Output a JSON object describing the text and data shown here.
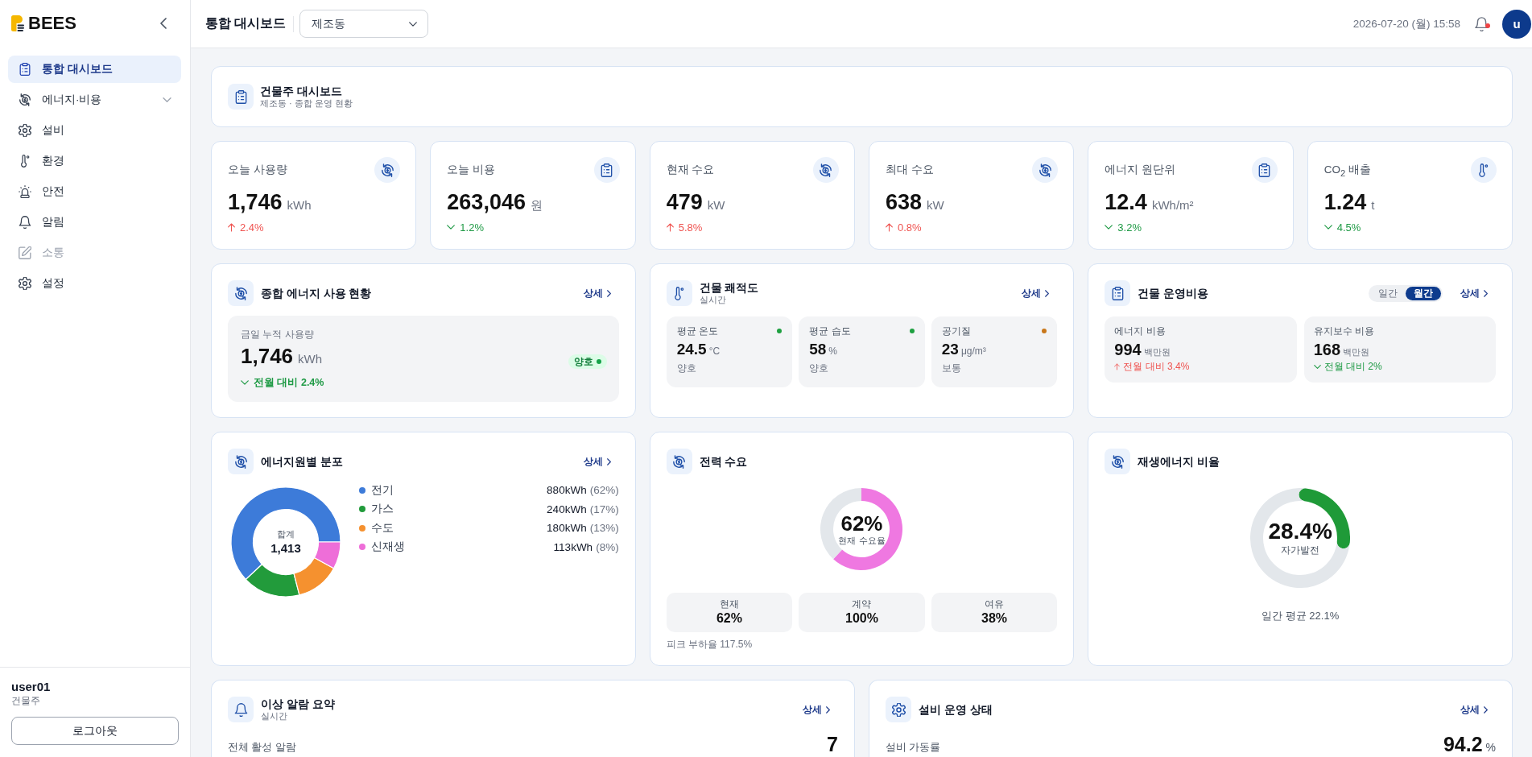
{
  "sidebar": {
    "logo": "BEES",
    "items": [
      {
        "label": "통합 대시보드",
        "selected": true,
        "disabled": false
      },
      {
        "label": "에너지·비용",
        "selected": false,
        "disabled": false,
        "expanded": false
      },
      {
        "label": "설비",
        "selected": false,
        "disabled": false
      },
      {
        "label": "환경",
        "selected": false,
        "disabled": false
      },
      {
        "label": "안전",
        "selected": false,
        "disabled": false
      },
      {
        "label": "알림",
        "selected": false,
        "disabled": false
      },
      {
        "label": "소통",
        "selected": false,
        "disabled": true
      },
      {
        "label": "설정",
        "selected": false,
        "disabled": false
      }
    ],
    "user": {
      "name": "user01",
      "role": "건물주"
    },
    "logout_button": "로그아웃"
  },
  "topbar": {
    "title": "통합 대시보드",
    "site_select": {
      "value": "제조동"
    },
    "datetime": "2026-07-20 (월) 15:58",
    "notifications": {
      "unread": true
    },
    "avatar": "u"
  },
  "header": {
    "title": "건물주 대시보드",
    "subtitle": "제조동 · 종합 운영 현황"
  },
  "kpis": [
    {
      "label": "오늘 사용량",
      "value": "1,746",
      "unit": "kWh",
      "increase": true,
      "change": "2.4%"
    },
    {
      "label": "오늘 비용",
      "value": "263,046",
      "unit": "원",
      "increase": false,
      "change": "1.2%"
    },
    {
      "label": "현재 수요",
      "value": "479",
      "unit": "kW",
      "increase": true,
      "change": "5.8%"
    },
    {
      "label": "최대 수요",
      "value": "638",
      "unit": "kW",
      "increase": true,
      "change": "0.8%"
    },
    {
      "label": "에너지 원단위",
      "value": "12.4",
      "unit": "kWh/m²",
      "increase": false,
      "change": "3.2%"
    },
    {
      "label": "CO$_{2}$ 배출",
      "value": "1.24",
      "unit": "t",
      "increase": false,
      "change": "4.5%"
    }
  ],
  "energy_overview": {
    "title": "종합 에너지 사용 현황",
    "link": "상세",
    "label": "금일 누적 사용량",
    "value": "1,746",
    "unit": "kWh",
    "increase": false,
    "change": "전월 대비 2.4%",
    "badge": "양호"
  },
  "comfort": {
    "title": "건물 쾌적도",
    "subtitle": "실시간",
    "link": "상세",
    "metrics": [
      {
        "label": "평균 온도",
        "value": "24.5",
        "unit": "°C",
        "status": "양호",
        "color": "#1ea040"
      },
      {
        "label": "평균 습도",
        "value": "58",
        "unit": "%",
        "status": "양호",
        "color": "#1ea040"
      },
      {
        "label": "공기질",
        "value": "23",
        "unit": "μg/m³",
        "status": "보통",
        "color": "#c8771b"
      }
    ]
  },
  "operating_cost": {
    "title": "건물 운영비용",
    "periods": [
      {
        "label": "일간",
        "selected": false
      },
      {
        "label": "월간",
        "selected": true
      }
    ],
    "link": "상세",
    "items": [
      {
        "label": "에너지 비용",
        "value": "994",
        "unit": "백만원",
        "increase": true,
        "change": "전월 대비 3.4%"
      },
      {
        "label": "유지보수 비용",
        "value": "168",
        "unit": "백만원",
        "increase": false,
        "change": "전월 대비 2%"
      }
    ]
  },
  "energy_sources": {
    "title": "에너지원별 분포",
    "link": "상세",
    "total_label": "합계",
    "total": "1,413",
    "legend": [
      {
        "value": "880kWh",
        "share": "(62%)",
        "color": "#3d7bd9"
      },
      {
        "value": "240kWh",
        "share": "(17%)",
        "color": "#229b3b"
      },
      {
        "value": "180kWh",
        "share": "(13%)",
        "color": "#f5912f"
      },
      {
        "value": "113kWh",
        "share": "(8%)",
        "color": "#ee6ed8"
      }
    ],
    "chart_data": {
      "type": "donut",
      "categories": [
        "전기",
        "가스",
        "수도",
        "신재생"
      ],
      "series": [
        {
          "values": [
            62,
            17,
            13,
            8
          ]
        }
      ]
    }
  },
  "power_demand": {
    "title": "전력 수요",
    "chart_data": {
      "type": "donut",
      "series": [
        {
          "values": [
            62,
            38
          ]
        }
      ]
    },
    "value": "62%",
    "caption": "현재 수요율",
    "stats": [
      {
        "label": "현재",
        "value": "62%"
      },
      {
        "label": "계약",
        "value": "100%"
      },
      {
        "label": "여유",
        "value": "38%"
      }
    ],
    "footer": "피크 부하율 117.5%"
  },
  "renewable": {
    "title": "재생에너지 비율",
    "chart_data": {
      "type": "donut",
      "series": [
        {
          "values": [
            28.4,
            71.6
          ]
        }
      ]
    },
    "value": "28.4%",
    "caption": "자가발전",
    "footer": "일간 평균 22.1%"
  },
  "alarms": {
    "title": "이상 알람 요약",
    "subtitle": "실시간",
    "link": "상세",
    "metric_label": "전체 활성 알람",
    "metric_value": "7"
  },
  "equipment": {
    "title": "설비 운영 상태",
    "link": "상세",
    "metric_label": "설비 가동률",
    "metric_value": "94.2",
    "metric_unit": "%"
  }
}
